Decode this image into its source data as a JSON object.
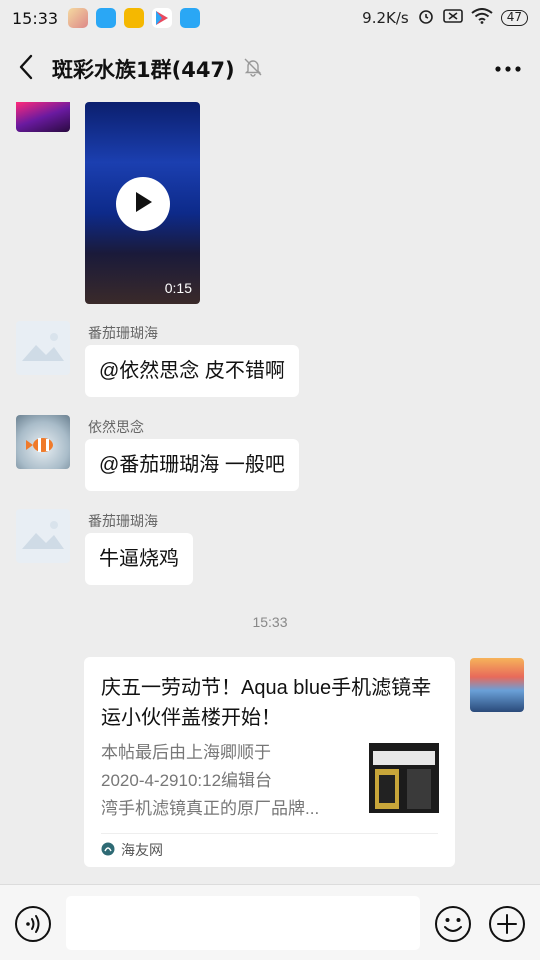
{
  "status_bar": {
    "time": "15:33",
    "net_speed": "9.2K/s",
    "battery": "47"
  },
  "header": {
    "title": "斑彩水族1群(447)",
    "back_icon": "chevron-left-icon",
    "mute_icon": "bell-off-icon",
    "more_icon": "more-horizontal-icon"
  },
  "messages": {
    "video": {
      "duration": "0:15"
    },
    "m1": {
      "sender": "番茄珊瑚海",
      "text": "@依然思念  皮不错啊"
    },
    "m2": {
      "sender": "依然思念",
      "text": "@番茄珊瑚海  一般吧"
    },
    "m3": {
      "sender": "番茄珊瑚海",
      "text": "牛逼烧鸡"
    },
    "timestamp": "15:33",
    "card": {
      "title": "庆五一劳动节！Aqua blue手机滤镜幸运小伙伴盖楼开始！",
      "desc": "本帖最后由上海卿顺于\n2020-4-2910:12编辑台\n湾手机滤镜真正的原厂品牌...",
      "source": "海友网"
    }
  },
  "colors": {
    "background": "#ededed",
    "bubble": "#ffffff"
  }
}
